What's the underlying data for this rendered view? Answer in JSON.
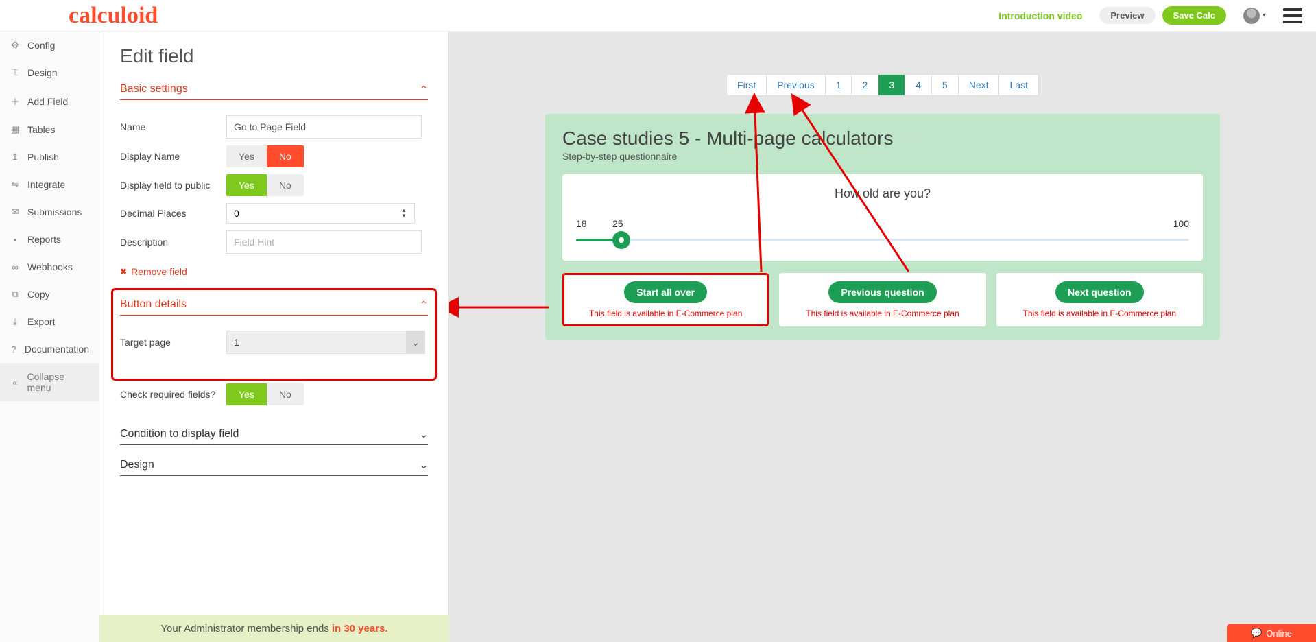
{
  "header": {
    "logo": "calculoid",
    "intro": "Introduction video",
    "preview": "Preview",
    "save": "Save Calc"
  },
  "sidebar": {
    "items": [
      {
        "icon": "⚙",
        "label": "Config"
      },
      {
        "icon": "⌶",
        "label": "Design"
      },
      {
        "icon": "＋",
        "label": "Add Field"
      },
      {
        "icon": "▦",
        "label": "Tables"
      },
      {
        "icon": "↥",
        "label": "Publish"
      },
      {
        "icon": "⇋",
        "label": "Integrate"
      },
      {
        "icon": "✉",
        "label": "Submissions"
      },
      {
        "icon": "▪",
        "label": "Reports"
      },
      {
        "icon": "∞",
        "label": "Webhooks"
      },
      {
        "icon": "⧉",
        "label": "Copy"
      },
      {
        "icon": "⤓",
        "label": "Export"
      },
      {
        "icon": "?",
        "label": "Documentation"
      }
    ],
    "collapse": {
      "icon": "«",
      "label": "Collapse menu"
    }
  },
  "editor": {
    "title": "Edit field",
    "basic": {
      "title": "Basic settings",
      "name_label": "Name",
      "name_value": "Go to Page Field",
      "display_name_label": "Display Name",
      "display_public_label": "Display field to public",
      "decimal_label": "Decimal Places",
      "decimal_value": "0",
      "description_label": "Description",
      "description_placeholder": "Field Hint",
      "yes": "Yes",
      "no": "No",
      "remove": "Remove field"
    },
    "button_details": {
      "title": "Button details",
      "target_label": "Target page",
      "target_value": "1",
      "check_req_label": "Check required fields?",
      "yes": "Yes",
      "no": "No"
    },
    "condition_title": "Condition to display field",
    "design_title": "Design"
  },
  "admin_note": {
    "text": "Your Administrator membership ends",
    "time": "in 30 years."
  },
  "pager": {
    "first": "First",
    "previous": "Previous",
    "pages": [
      "1",
      "2",
      "3",
      "4",
      "5"
    ],
    "active_index": 2,
    "next": "Next",
    "last": "Last"
  },
  "calc": {
    "title": "Case studies 5 - Multi-page calculators",
    "subtitle": "Step-by-step questionnaire",
    "question": "How old are you?",
    "slider": {
      "min": "18",
      "value": "25",
      "max": "100"
    },
    "buttons": [
      {
        "label": "Start all over",
        "note": "This field is available in E-Commerce plan"
      },
      {
        "label": "Previous question",
        "note": "This field is available in E-Commerce plan"
      },
      {
        "label": "Next question",
        "note": "This field is available in E-Commerce plan"
      }
    ]
  },
  "online": "Online"
}
